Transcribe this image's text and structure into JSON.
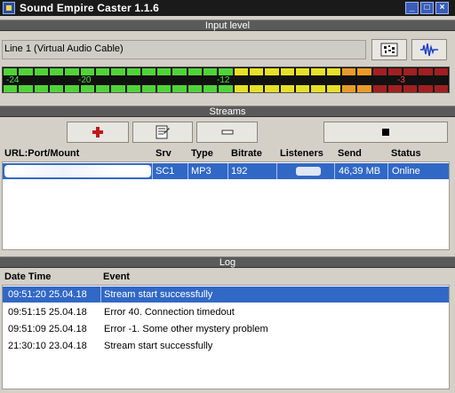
{
  "window": {
    "title": "Sound Empire Caster 1.1.6",
    "controls": [
      "_",
      "□",
      "×"
    ]
  },
  "input_level": {
    "header": "Input level",
    "device": "Line 1 (Virtual Audio Cable)",
    "meter_labels": [
      "-24",
      "-20",
      "-12",
      "-3"
    ],
    "buttons": [
      "settings-icon",
      "waveform-icon"
    ]
  },
  "streams": {
    "header": "Streams",
    "toolbar": [
      "add-icon",
      "edit-icon",
      "minus-icon",
      "stop-icon"
    ],
    "columns": [
      "URL:Port/Mount",
      "Srv",
      "Type",
      "Bitrate",
      "Listeners",
      "Send",
      "Status"
    ],
    "rows": [
      {
        "url": "",
        "srv": "SC1",
        "type": "MP3",
        "bitrate": "192",
        "listeners": "",
        "send": "46,39 MB",
        "status": "Online"
      }
    ]
  },
  "log": {
    "header": "Log",
    "columns": [
      "Date Time",
      "Event"
    ],
    "rows": [
      {
        "datetime": "09:51:20 25.04.18",
        "event": "Stream start successfully"
      },
      {
        "datetime": "09:51:15 25.04.18",
        "event": "Error 40. Connection timedout"
      },
      {
        "datetime": "09:51:09 25.04.18",
        "event": "Error -1. Some other mystery problem"
      },
      {
        "datetime": "21:30:10 23.04.18",
        "event": "Stream start successfully"
      }
    ]
  },
  "colors": {
    "selection": "#3168c6",
    "meter_green": "#52d23a",
    "meter_yellow": "#e6e028",
    "meter_orange": "#e89b2a",
    "meter_red": "#a02020"
  }
}
